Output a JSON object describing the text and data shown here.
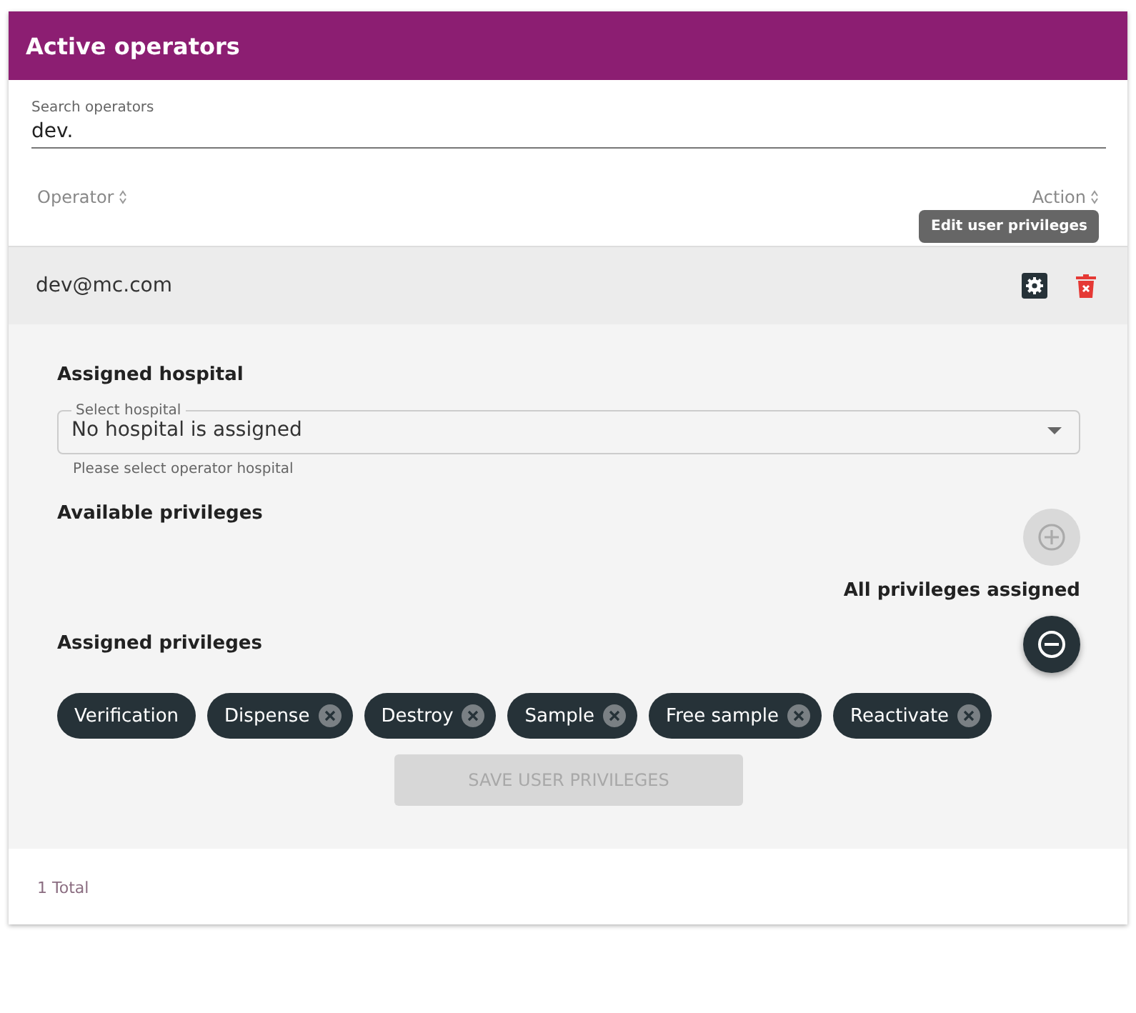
{
  "header": {
    "title": "Active operators"
  },
  "search": {
    "label": "Search operators",
    "value": "dev."
  },
  "columns": [
    {
      "label": "Operator"
    },
    {
      "label": "Action"
    }
  ],
  "rows": [
    {
      "operator": "dev@mc.com",
      "expanded": true,
      "tooltip": "Edit user privileges"
    }
  ],
  "detail": {
    "hospital_heading": "Assigned hospital",
    "hospital_select": {
      "label": "Select hospital",
      "value": "No hospital is assigned",
      "helper": "Please select operator hospital"
    },
    "available_heading": "Available privileges",
    "add_disabled": true,
    "available_message": "All privileges assigned",
    "assigned_heading": "Assigned privileges",
    "assigned": [
      {
        "label": "Verification",
        "deletable": false
      },
      {
        "label": "Dispense",
        "deletable": true
      },
      {
        "label": "Destroy",
        "deletable": true
      },
      {
        "label": "Sample",
        "deletable": true
      },
      {
        "label": "Free sample",
        "deletable": true
      },
      {
        "label": "Reactivate",
        "deletable": true
      }
    ],
    "save_button": {
      "label": "SAVE USER PRIVILEGES",
      "disabled": true
    }
  },
  "footer": {
    "total": "1 Total"
  }
}
